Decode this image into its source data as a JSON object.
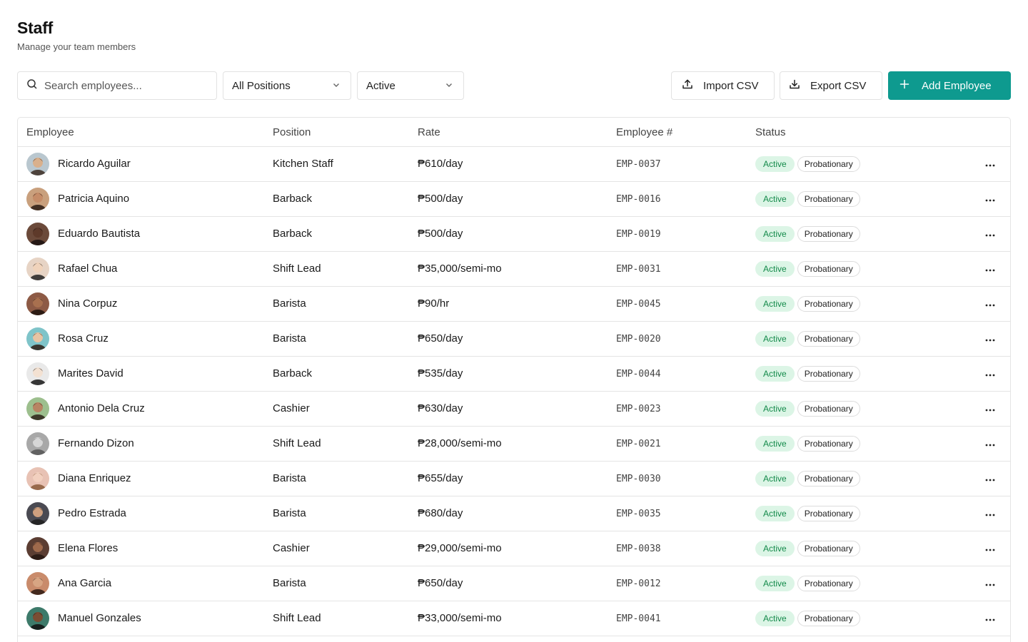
{
  "header": {
    "title": "Staff",
    "subtitle": "Manage your team members"
  },
  "toolbar": {
    "search_placeholder": "Search employees...",
    "positions_filter": "All Positions",
    "status_filter": "Active",
    "import_label": "Import CSV",
    "export_label": "Export CSV",
    "add_label": "Add Employee"
  },
  "colors": {
    "primary": "#0e9a8f",
    "active_badge_bg": "#dcf5e6",
    "active_badge_text": "#138a4a"
  },
  "table": {
    "columns": {
      "employee": "Employee",
      "position": "Position",
      "rate": "Rate",
      "number": "Employee #",
      "status": "Status"
    },
    "rows": [
      {
        "name": "Ricardo Aguilar",
        "position": "Kitchen Staff",
        "rate": "₱610/day",
        "number": "EMP-0037",
        "status": "Active",
        "type": "Probationary"
      },
      {
        "name": "Patricia Aquino",
        "position": "Barback",
        "rate": "₱500/day",
        "number": "EMP-0016",
        "status": "Active",
        "type": "Probationary"
      },
      {
        "name": "Eduardo Bautista",
        "position": "Barback",
        "rate": "₱500/day",
        "number": "EMP-0019",
        "status": "Active",
        "type": "Probationary"
      },
      {
        "name": "Rafael Chua",
        "position": "Shift Lead",
        "rate": "₱35,000/semi-mo",
        "number": "EMP-0031",
        "status": "Active",
        "type": "Probationary"
      },
      {
        "name": "Nina Corpuz",
        "position": "Barista",
        "rate": "₱90/hr",
        "number": "EMP-0045",
        "status": "Active",
        "type": "Probationary"
      },
      {
        "name": "Rosa Cruz",
        "position": "Barista",
        "rate": "₱650/day",
        "number": "EMP-0020",
        "status": "Active",
        "type": "Probationary"
      },
      {
        "name": "Marites David",
        "position": "Barback",
        "rate": "₱535/day",
        "number": "EMP-0044",
        "status": "Active",
        "type": "Probationary"
      },
      {
        "name": "Antonio Dela Cruz",
        "position": "Cashier",
        "rate": "₱630/day",
        "number": "EMP-0023",
        "status": "Active",
        "type": "Probationary"
      },
      {
        "name": "Fernando Dizon",
        "position": "Shift Lead",
        "rate": "₱28,000/semi-mo",
        "number": "EMP-0021",
        "status": "Active",
        "type": "Probationary"
      },
      {
        "name": "Diana Enriquez",
        "position": "Barista",
        "rate": "₱655/day",
        "number": "EMP-0030",
        "status": "Active",
        "type": "Probationary"
      },
      {
        "name": "Pedro Estrada",
        "position": "Barista",
        "rate": "₱680/day",
        "number": "EMP-0035",
        "status": "Active",
        "type": "Probationary"
      },
      {
        "name": "Elena Flores",
        "position": "Cashier",
        "rate": "₱29,000/semi-mo",
        "number": "EMP-0038",
        "status": "Active",
        "type": "Probationary"
      },
      {
        "name": "Ana Garcia",
        "position": "Barista",
        "rate": "₱650/day",
        "number": "EMP-0012",
        "status": "Active",
        "type": "Probationary"
      },
      {
        "name": "Manuel Gonzales",
        "position": "Shift Lead",
        "rate": "₱33,000/semi-mo",
        "number": "EMP-0041",
        "status": "Active",
        "type": "Probationary"
      }
    ]
  }
}
